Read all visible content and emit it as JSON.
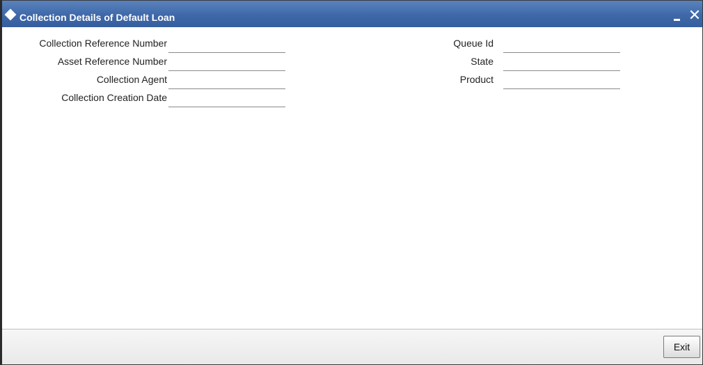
{
  "window": {
    "title": "Collection Details of Default Loan",
    "minimize_label": "",
    "close_label": "✕"
  },
  "form": {
    "left_fields": [
      {
        "label": "Collection Reference Number",
        "value": ""
      },
      {
        "label": "Asset Reference Number",
        "value": ""
      },
      {
        "label": "Collection Agent",
        "value": ""
      },
      {
        "label": "Collection Creation Date",
        "value": ""
      }
    ],
    "right_fields": [
      {
        "label": "Queue Id",
        "value": ""
      },
      {
        "label": "State",
        "value": ""
      },
      {
        "label": "Product",
        "value": ""
      }
    ]
  },
  "footer": {
    "exit_label": "Exit"
  },
  "colors": {
    "titlebar": "#3f68a8",
    "title_text": "#ffffff",
    "field_underline": "#8a8a8a"
  },
  "icons": {
    "title_icon": "diamond-icon",
    "minimize_icon": "minimize-icon",
    "close_icon": "close-icon"
  }
}
